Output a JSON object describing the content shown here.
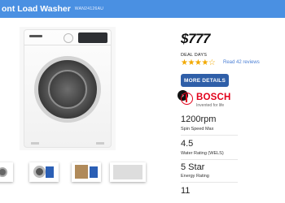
{
  "header": {
    "title": "ont Load Washer",
    "model": "WAN24126AU"
  },
  "product": {
    "price": "$777",
    "deal_label": "DEAL DAYS",
    "rating": 4.5,
    "rating_max": 5,
    "stars_glyphs": "★★★★☆",
    "reviews_link": "Read 42 reviews",
    "more_details_label": "MORE DETAILS",
    "brand": "BOSCH",
    "tagline": "Invented for life"
  },
  "specs": [
    {
      "value": "1200rpm",
      "label": "Spin Speed Max"
    },
    {
      "value": "4.5",
      "label": "Water Rating (WELS)"
    },
    {
      "value": "5 Star",
      "label": "Energy Rating"
    },
    {
      "value": "11",
      "label": ""
    }
  ],
  "gallery": {
    "next_icon": "chevron-right-icon",
    "next_glyph": "›"
  },
  "colors": {
    "header": "#4a90e2",
    "button": "#2f5fa8",
    "brand_red": "#e2001a",
    "stars": "#f2a900",
    "link": "#4a7fd4"
  }
}
